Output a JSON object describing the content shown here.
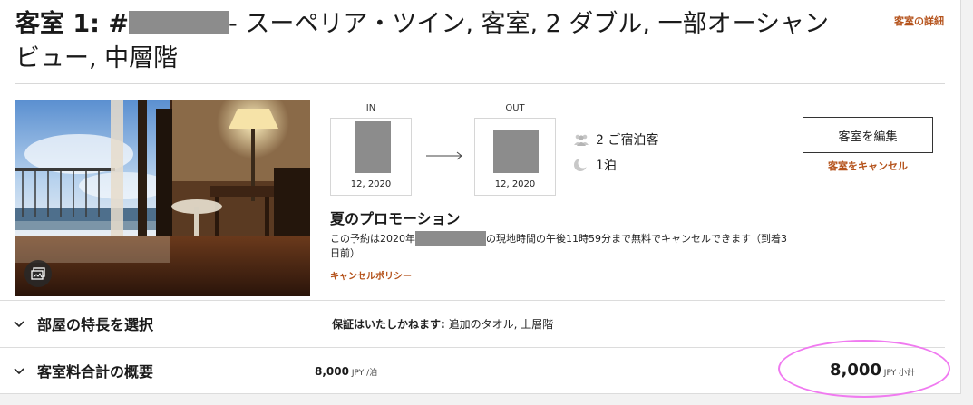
{
  "header": {
    "room_prefix": "客室 1: #",
    "room_name": "- スーペリア・ツイン, 客室, 2 ダブル, 一部オーシャンビュー, 中層階",
    "details_link": "客室の詳細"
  },
  "stay": {
    "checkin_label": "IN",
    "checkin_year": "12, 2020",
    "checkout_label": "OUT",
    "checkout_year": "12, 2020",
    "guests": "2 ご宿泊客",
    "nights": "1泊"
  },
  "actions": {
    "edit_button": "客室を編集",
    "cancel_link": "客室をキャンセル"
  },
  "promo": {
    "title": "夏のプロモーション",
    "text_before": "この予約は2020年",
    "text_after": "の現地時間の午後11時59分まで無料でキャンセルできます（到着3日前）",
    "policy_link": "キャンセルポリシー"
  },
  "features": {
    "label": "部屋の特長を選択",
    "guarantee_label": "保証はいたしかねます:",
    "guarantee_value": " 追加のタオル,  上層階"
  },
  "rate": {
    "label": "客室料合計の概要",
    "nightly_amount": "8,000",
    "nightly_unit": " JPY /泊",
    "subtotal_amount": "8,000",
    "subtotal_unit": " JPY 小計"
  },
  "colors": {
    "accent_link": "#b5531c",
    "highlight": "#f07af0",
    "redaction": "#8c8c8c"
  },
  "icons": [
    "gallery-icon",
    "arrow-right-icon",
    "guests-icon",
    "moon-icon",
    "chevron-down-icon"
  ]
}
